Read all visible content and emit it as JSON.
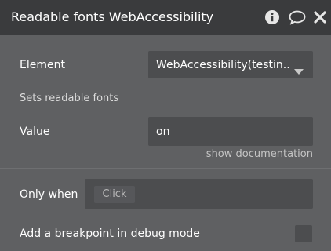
{
  "header": {
    "title": "Readable fonts WebAccessibility",
    "icons": [
      "info-icon",
      "comment-icon",
      "close-icon"
    ]
  },
  "fields": {
    "element_label": "Element",
    "element_value": "WebAccessibility(testin...",
    "description": "Sets readable fonts",
    "value_label": "Value",
    "value_value": "on",
    "show_doc": "show documentation",
    "only_when_label": "Only when",
    "only_when_placeholder": "Click",
    "breakpoint_label": "Add a breakpoint in debug mode"
  },
  "colors": {
    "panel": "#5f6062",
    "header": "#3a3b3d",
    "field": "#4c4d4f"
  }
}
